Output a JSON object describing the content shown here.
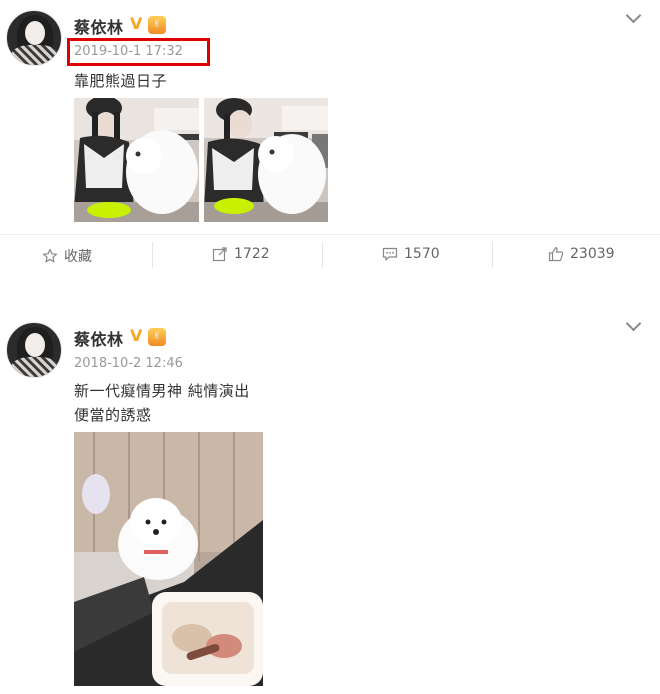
{
  "posts": [
    {
      "username": "蔡依林",
      "verified_mark": "V",
      "timestamp": "2019-10-1 17:32",
      "text_lines": [
        "靠肥熊過日子"
      ],
      "actions": {
        "favorite_label": "收藏",
        "repost_count": "1722",
        "comment_count": "1570",
        "like_count": "23039"
      }
    },
    {
      "username": "蔡依林",
      "verified_mark": "V",
      "timestamp": "2018-10-2 12:46",
      "text_lines": [
        "新一代癡情男神 純情演出",
        "便當的誘惑"
      ]
    }
  ],
  "colors": {
    "highlight": "#e00000",
    "verify": "#f5a623",
    "timestamp": "#999999"
  }
}
